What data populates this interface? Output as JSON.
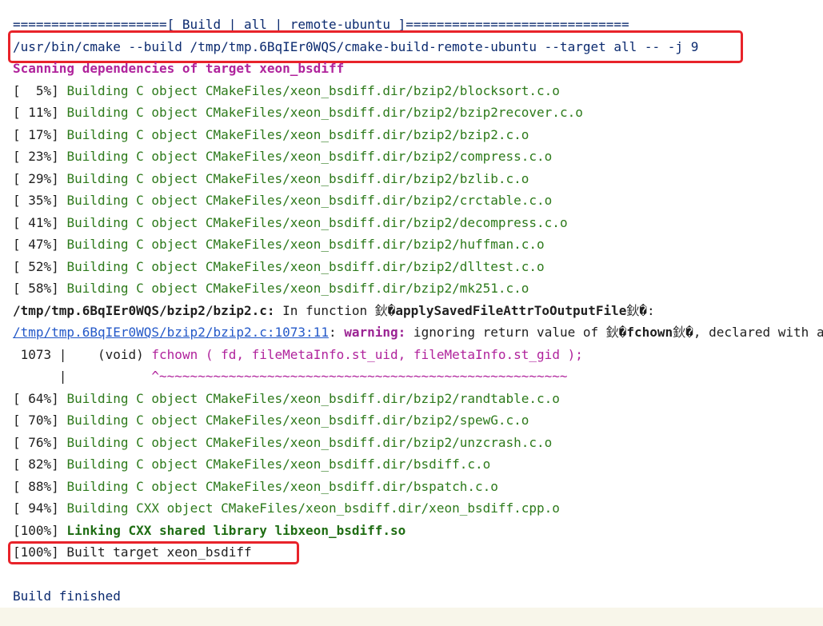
{
  "build_output": {
    "header": "====================[ Build | all | remote-ubuntu ]=============================",
    "command": "/usr/bin/cmake --build /tmp/tmp.6BqIEr0WQS/cmake-build-remote-ubuntu --target all -- -j 9",
    "scanning": "Scanning dependencies of target xeon_bsdiff",
    "progress_group_1": [
      {
        "pct": "[  5%]",
        "action": "Building C object CMakeFiles/xeon_bsdiff.dir/bzip2/blocksort.c.o"
      },
      {
        "pct": "[ 11%]",
        "action": "Building C object CMakeFiles/xeon_bsdiff.dir/bzip2/bzip2recover.c.o"
      },
      {
        "pct": "[ 17%]",
        "action": "Building C object CMakeFiles/xeon_bsdiff.dir/bzip2/bzip2.c.o"
      },
      {
        "pct": "[ 23%]",
        "action": "Building C object CMakeFiles/xeon_bsdiff.dir/bzip2/compress.c.o"
      },
      {
        "pct": "[ 29%]",
        "action": "Building C object CMakeFiles/xeon_bsdiff.dir/bzip2/bzlib.c.o"
      },
      {
        "pct": "[ 35%]",
        "action": "Building C object CMakeFiles/xeon_bsdiff.dir/bzip2/crctable.c.o"
      },
      {
        "pct": "[ 41%]",
        "action": "Building C object CMakeFiles/xeon_bsdiff.dir/bzip2/decompress.c.o"
      },
      {
        "pct": "[ 47%]",
        "action": "Building C object CMakeFiles/xeon_bsdiff.dir/bzip2/huffman.c.o"
      },
      {
        "pct": "[ 52%]",
        "action": "Building C object CMakeFiles/xeon_bsdiff.dir/bzip2/dlltest.c.o"
      },
      {
        "pct": "[ 58%]",
        "action": "Building C object CMakeFiles/xeon_bsdiff.dir/bzip2/mk251.c.o"
      }
    ],
    "function_note": {
      "file": "/tmp/tmp.6BqIEr0WQS/bzip2/bzip2.c:",
      "text": " In function 鈥�",
      "func": "applySavedFileAttrToOutputFile",
      "end": "鈥�:"
    },
    "warning_line": {
      "link": "/tmp/tmp.6BqIEr0WQS/bzip2/bzip2.c:1073:11",
      "colon": ":",
      "label": " warning:",
      "text": " ignoring return value of 鈥�",
      "func": "fchown",
      "rest": "鈥�, declared with attribute warn_unused_result"
    },
    "source_line": {
      "gutter": " 1073 |    ",
      "prefix": "(void) ",
      "code": "fchown ( fd, fileMetaInfo.st_uid, fileMetaInfo.st_gid );"
    },
    "caret_line": {
      "gutter": "      |           ",
      "caret": "^~~~~~~~~~~~~~~~~~~~~~~~~~~~~~~~~~~~~~~~~~~~~~~~~~~~~~"
    },
    "progress_group_2": [
      {
        "pct": "[ 64%]",
        "action": "Building C object CMakeFiles/xeon_bsdiff.dir/bzip2/randtable.c.o"
      },
      {
        "pct": "[ 70%]",
        "action": "Building C object CMakeFiles/xeon_bsdiff.dir/bzip2/spewG.c.o"
      },
      {
        "pct": "[ 76%]",
        "action": "Building C object CMakeFiles/xeon_bsdiff.dir/bzip2/unzcrash.c.o"
      },
      {
        "pct": "[ 82%]",
        "action": "Building C object CMakeFiles/xeon_bsdiff.dir/bsdiff.c.o"
      },
      {
        "pct": "[ 88%]",
        "action": "Building C object CMakeFiles/xeon_bsdiff.dir/bspatch.c.o"
      },
      {
        "pct": "[ 94%]",
        "action": "Building CXX object CMakeFiles/xeon_bsdiff.dir/xeon_bsdiff.cpp.o"
      }
    ],
    "linking": {
      "pct": "[100%]",
      "action": " Linking CXX shared library libxeon_bsdiff.so"
    },
    "built": "[100%] Built target xeon_bsdiff",
    "finished": "Build finished"
  },
  "colors": {
    "highlight_box": "#e8232a",
    "navy_text": "#0b2a6f",
    "purple_text": "#b0239c",
    "green_text": "#2d7a1b",
    "link": "#2358c8"
  }
}
